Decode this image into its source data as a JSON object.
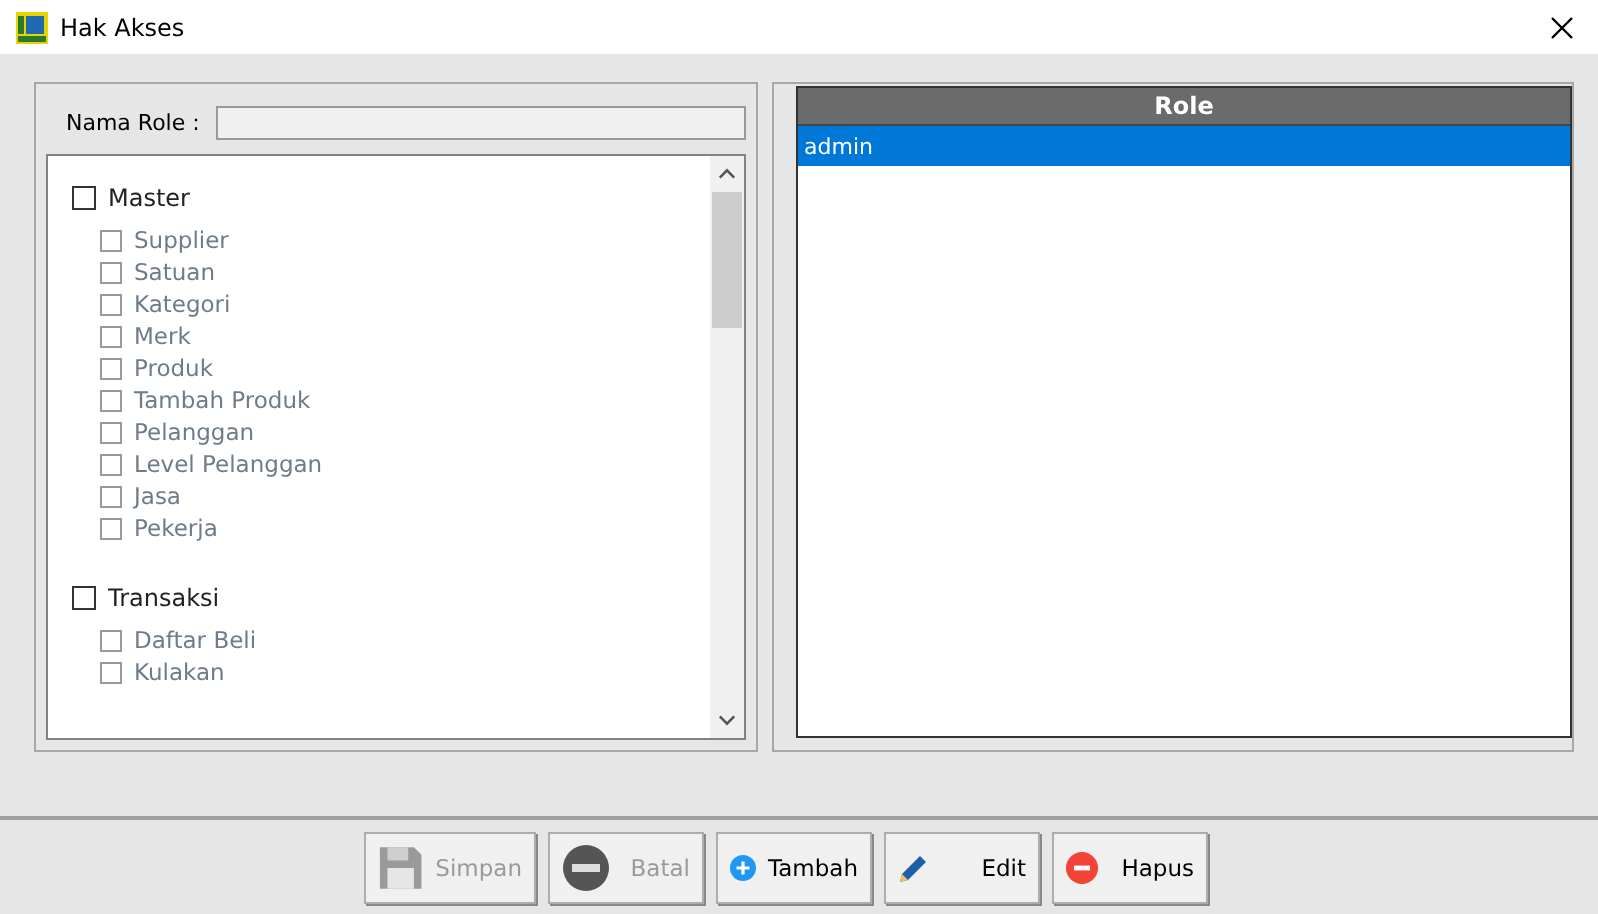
{
  "window": {
    "title": "Hak Akses"
  },
  "form": {
    "label": "Nama Role :"
  },
  "groups": [
    {
      "label": "Master",
      "checked": false,
      "children": [
        {
          "label": "Supplier",
          "checked": false
        },
        {
          "label": "Satuan",
          "checked": false
        },
        {
          "label": "Kategori",
          "checked": false
        },
        {
          "label": "Merk",
          "checked": false
        },
        {
          "label": "Produk",
          "checked": false
        },
        {
          "label": "Tambah Produk",
          "checked": false
        },
        {
          "label": "Pelanggan",
          "checked": false
        },
        {
          "label": "Level Pelanggan",
          "checked": false
        },
        {
          "label": "Jasa",
          "checked": false
        },
        {
          "label": "Pekerja",
          "checked": false
        }
      ]
    },
    {
      "label": "Transaksi",
      "checked": false,
      "children": [
        {
          "label": "Daftar Beli",
          "checked": false
        },
        {
          "label": "Kulakan",
          "checked": false
        }
      ]
    }
  ],
  "table": {
    "columns": [
      "Role"
    ],
    "rows": [
      {
        "cells": [
          "admin"
        ],
        "selected": true
      }
    ]
  },
  "buttons": [
    {
      "label": "Simpan",
      "kind": "save",
      "disabled": true
    },
    {
      "label": "Batal",
      "kind": "cancel",
      "disabled": true
    },
    {
      "label": "Tambah",
      "kind": "add",
      "disabled": false
    },
    {
      "label": "Edit",
      "kind": "edit",
      "disabled": false
    },
    {
      "label": "Hapus",
      "kind": "delete",
      "disabled": false
    }
  ]
}
